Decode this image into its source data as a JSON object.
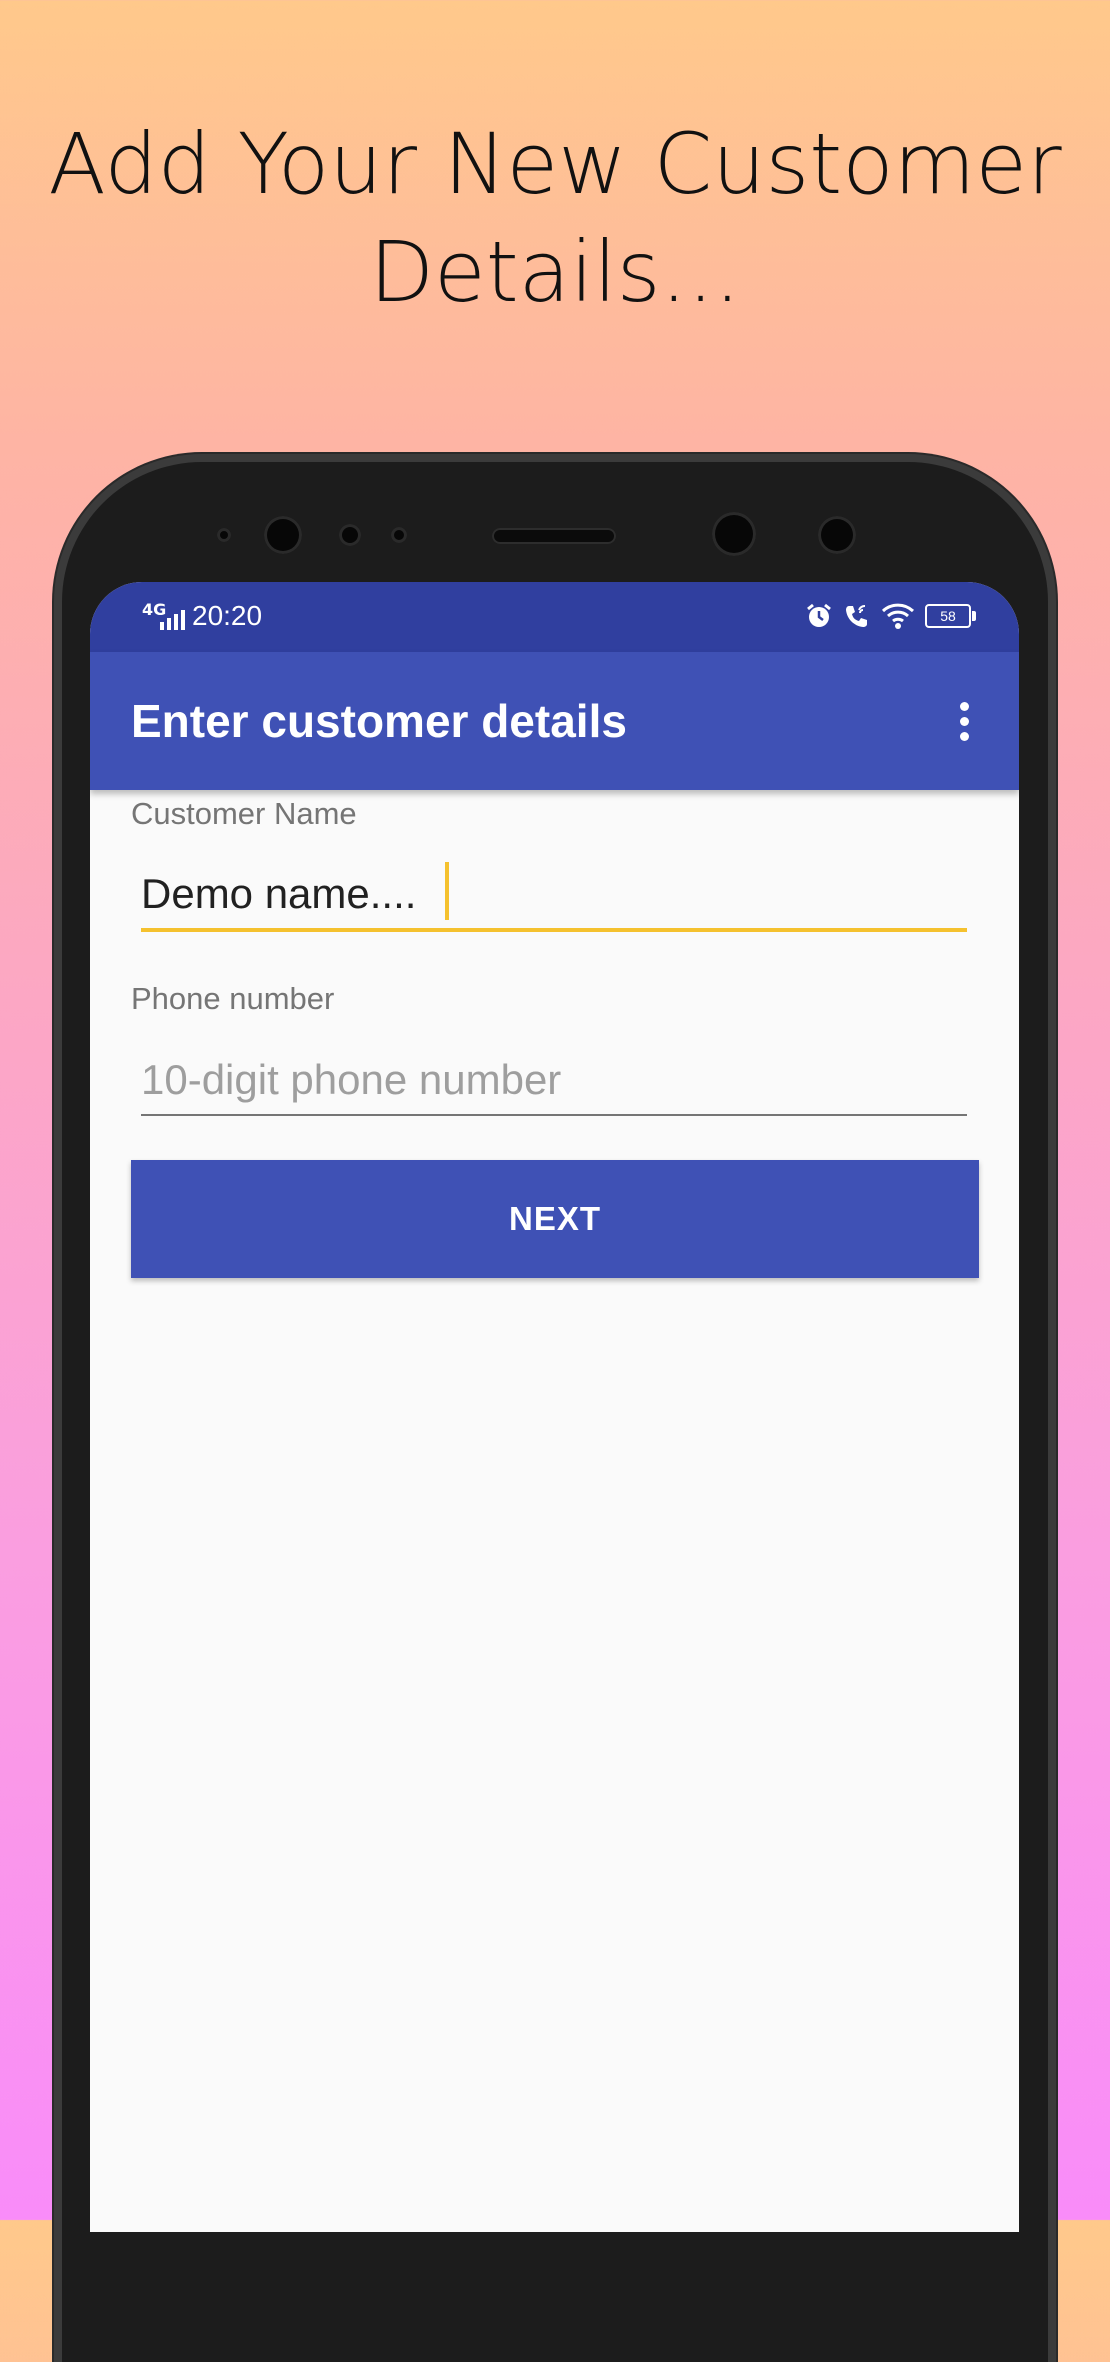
{
  "headline": {
    "line1": "Add Your New Customer",
    "line2": "Details..."
  },
  "status_bar": {
    "network": "4G",
    "time": "20:20",
    "battery": "58",
    "icons": [
      "signal-icon",
      "alarm-icon",
      "wifi-calling-icon",
      "wifi-icon",
      "battery-icon"
    ]
  },
  "app_bar": {
    "title": "Enter customer details",
    "menu_icon": "more-vert-icon"
  },
  "form": {
    "customer_name": {
      "label": "Customer Name",
      "value": "Demo name...."
    },
    "phone_number": {
      "label": "Phone number",
      "placeholder": "10-digit phone number",
      "value": ""
    },
    "next_label": "NEXT"
  },
  "colors": {
    "primary": "#3f51b5",
    "primary_dark": "#303f9f",
    "accent": "#f5c12e",
    "screen_background": "#fafafa"
  }
}
